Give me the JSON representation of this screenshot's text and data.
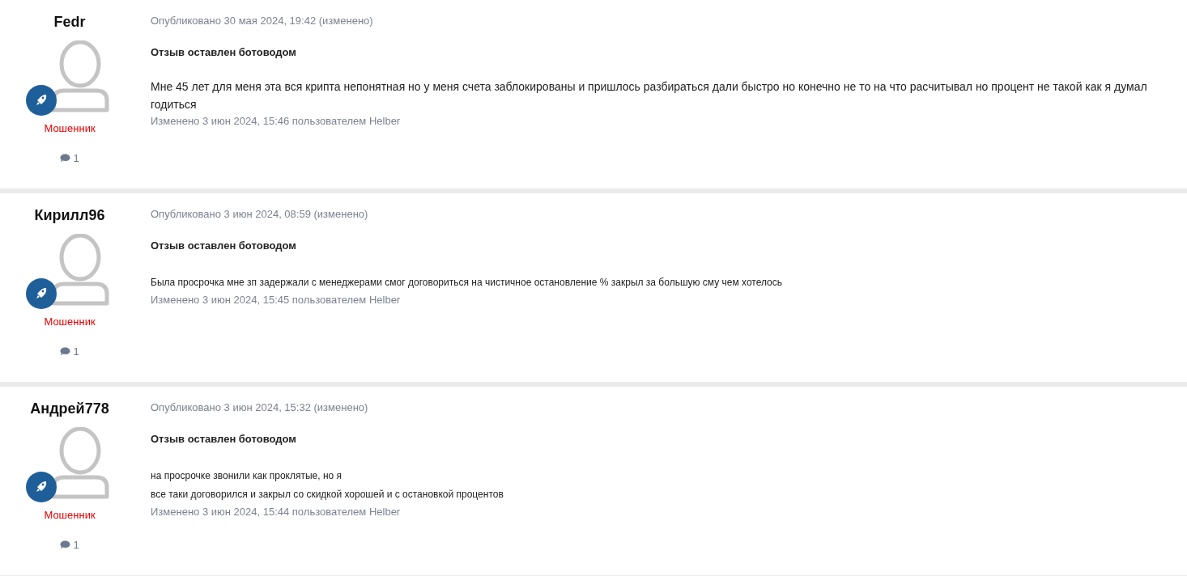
{
  "posts": [
    {
      "author": "Fedr",
      "rank": "Мошенник",
      "comment_count": "1",
      "published": "Опубликовано 30 мая 2024, 19:42 (изменено)",
      "title": "Отзыв оставлен ботоводом",
      "kind": "normal",
      "paragraphs": [
        "Мне 45 лет для меня эта вся крипта непонятная но у меня счета заблокированы и пришлось разбираться дали быстро но конечно не то на что расчитывал но процент не такой как я думал годиться"
      ],
      "edited": "Изменено 3 июн 2024, 15:46 пользователем Helber"
    },
    {
      "author": "Кирилл96",
      "rank": "Мошенник",
      "comment_count": "1",
      "published": "Опубликовано 3 июн 2024, 08:59 (изменено)",
      "title": "Отзыв оставлен ботоводом",
      "kind": "small",
      "paragraphs": [
        "Была просрочка мне зп задержали с менеджерами смог договориться на чистичное остановление % закрыл за большую сму чем хотелось"
      ],
      "edited": "Изменено 3 июн 2024, 15:45 пользователем Helber"
    },
    {
      "author": "Андрей778",
      "rank": "Мошенник",
      "comment_count": "1",
      "published": "Опубликовано 3 июн 2024, 15:32 (изменено)",
      "title": "Отзыв оставлен ботоводом",
      "kind": "small",
      "paragraphs": [
        "на просрочке звонили как проклятые, но я",
        "все таки договорился  и закрыл со скидкой хорошей и с остановкой процентов"
      ],
      "edited": "Изменено 3 июн 2024, 15:44 пользователем Helber"
    }
  ]
}
